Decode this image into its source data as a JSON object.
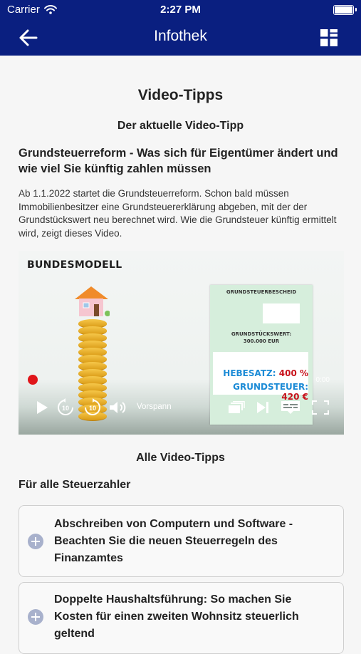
{
  "status_bar": {
    "carrier": "Carrier",
    "time": "2:27 PM"
  },
  "nav": {
    "title": "Infothek"
  },
  "page": {
    "title": "Video-Tipps",
    "current_tip_heading": "Der aktuelle Video-Tipp",
    "article_title": "Grundsteuerreform - Was sich für Eigentümer ändert und wie viel Sie künftig zahlen müssen",
    "article_description": "Ab 1.1.2022 startet die Grundsteuerreform. Schon bald müssen Immobilienbesitzer eine Grundsteuererklärung abgeben, mit der der Grundstückswert neu berechnet wird. Wie die Grundsteuer künftig ermittelt wird, zeigt dieses Video."
  },
  "video": {
    "overlay_label": "BUNDESMODELL",
    "doc_heading": "GRUNDSTEUERBESCHEID",
    "doc_value_label": "GRUNDSTÜCKSWERT:",
    "doc_value": "300.000 EUR",
    "hebesatz_label": "HEBESATZ:",
    "hebesatz_value": "400 %",
    "grundsteuer_label": "GRUNDSTEUER:",
    "grundsteuer_value": "420 €",
    "time": "0:00",
    "chapter": "Vorspann",
    "skip_back_seconds": "10",
    "skip_forward_seconds": "10"
  },
  "all_tips": {
    "heading": "Alle Video-Tipps",
    "section_heading": "Für alle Steuerzahler",
    "items": [
      {
        "title": "Abschreiben von Computern und Software - Beachten Sie die neuen Steuerregeln des Finanzamtes"
      },
      {
        "title": "Doppelte Haushaltsführung: So machen Sie Kosten für einen zweiten Wohnsitz steuerlich geltend"
      }
    ]
  },
  "colors": {
    "nav_bar": "#0a1f80",
    "plus_icon": "#a8b1cc",
    "hebesatz": "#1c8bd6",
    "steuer_value": "#c8111b"
  }
}
